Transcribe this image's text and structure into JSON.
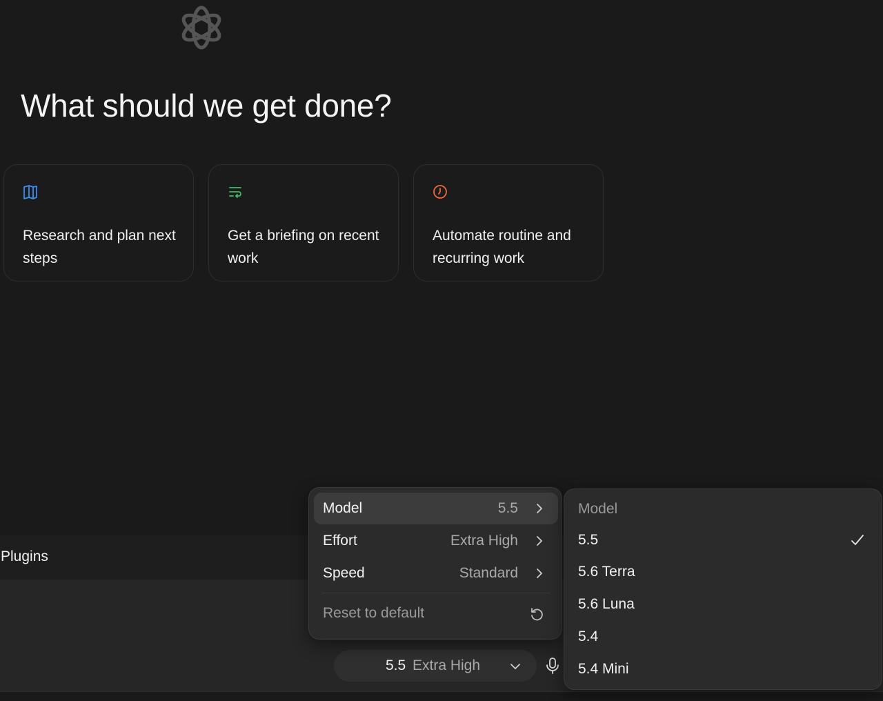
{
  "headline": "What should we get done?",
  "colors": {
    "background": "#1a1a1a",
    "research_icon": "#3b8ef0",
    "briefing_icon": "#3fbf6a",
    "automate_icon": "#f06a3a"
  },
  "cards": [
    {
      "icon": "book-open-icon",
      "text": "Research and plan next steps"
    },
    {
      "icon": "list-wrap-icon",
      "text": "Get a briefing on recent work"
    },
    {
      "icon": "clock-icon",
      "text": "Automate routine and recurring work"
    }
  ],
  "plugins": {
    "label": "Plugins"
  },
  "composer": {
    "model": "5.5",
    "effort": "Extra High"
  },
  "menu": {
    "model_label": "Model",
    "model_value": "5.5",
    "effort_label": "Effort",
    "effort_value": "Extra High",
    "speed_label": "Speed",
    "speed_value": "Standard",
    "reset_label": "Reset to default"
  },
  "submenu": {
    "title": "Model",
    "selected": "5.5",
    "items": [
      "5.5",
      "5.6 Terra",
      "5.6 Luna",
      "5.4",
      "5.4 Mini"
    ]
  }
}
